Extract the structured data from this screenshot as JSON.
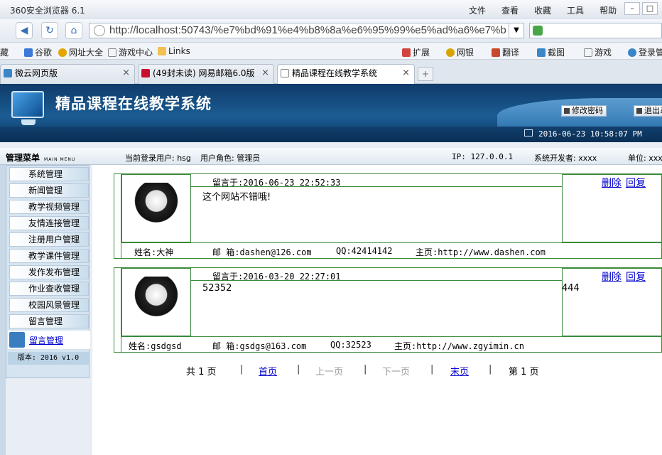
{
  "browser": {
    "app_title": "360安全浏览器 6.1",
    "menu": [
      "文件",
      "查看",
      "收藏",
      "工具",
      "帮助"
    ],
    "url": "http://localhost:50743/%e7%bd%91%e4%b8%8a%e6%95%99%e5%ad%a6%e7%b",
    "favorites": [
      "藏",
      "谷歌",
      "网址大全",
      "游戏中心",
      "Links",
      "扩展",
      "网银",
      "翻译",
      "截图",
      "游戏",
      "登录管"
    ],
    "tabs": [
      "微云网页版",
      "(49封未读) 网易邮箱6.0版",
      "精品课程在线教学系统"
    ]
  },
  "header": {
    "title": "精品课程在线教学系统",
    "change_password": "修改密码",
    "logout": "退出系",
    "datetime": "2016-06-23 10:58:07 PM"
  },
  "infobar": {
    "menu_title": "管理菜单",
    "menu_sub": "MAIN MENU",
    "current_user": "当前登录用户: hsg",
    "role": "用户角色: 管理员",
    "ip": "IP: 127.0.0.1",
    "developer": "系统开发者: xxxx",
    "unit": "单位: xxx"
  },
  "sidebar": {
    "items": [
      "系统管理",
      "新闻管理",
      "教学视频管理",
      "友情连接管理",
      "注册用户管理",
      "教学课件管理",
      "发作发布管理",
      "作业查收管理",
      "校园风景管理",
      "留言管理"
    ],
    "active": "留言管理",
    "version": "版本: 2016 v1.0"
  },
  "messages": [
    {
      "time": "留言于:2016-06-23 22:52:33",
      "content": "这个网站不错哦!",
      "reply_text": "",
      "delete": "删除",
      "reply": "回复",
      "name": "姓名:大神",
      "email": "邮 箱:dashen@126.com",
      "qq": "QQ:42414142",
      "homepage": "主页:http://www.dashen.com"
    },
    {
      "time": "留言于:2016-03-20 22:27:01",
      "content": "52352",
      "reply_text": "444",
      "delete": "删除",
      "reply": "回复",
      "name": "姓名:gsdgsd",
      "email": "邮 箱:gsdgs@163.com",
      "qq": "QQ:32523",
      "homepage": "主页:http://www.zgyimin.cn"
    }
  ],
  "pager": {
    "total": "共 1 页",
    "first": "首页",
    "prev": "上一页",
    "next": "下一页",
    "last": "末页",
    "current": "第 1 页",
    "sep": "|"
  }
}
